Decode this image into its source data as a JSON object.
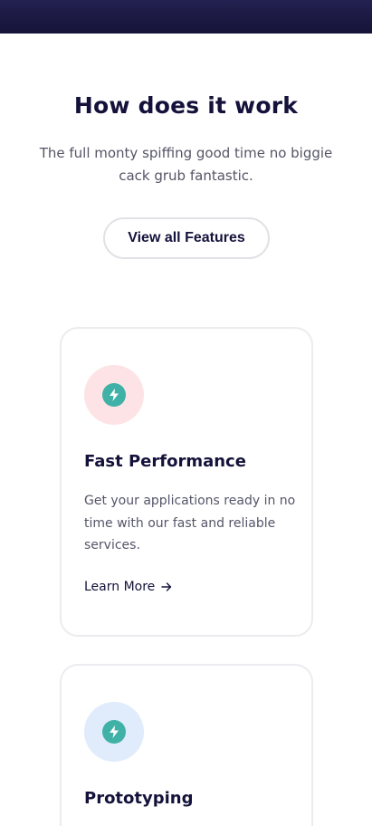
{
  "hero": {
    "title": "How does it work",
    "subtitle": "The full monty spiffing good time no biggie cack grub fantastic.",
    "button_label": "View all Features"
  },
  "cards": [
    {
      "icon": "lightning-bolt-icon",
      "icon_bg": "#fde3e5",
      "icon_color": "#3fb1a6",
      "title": "Fast Performance",
      "description": "Get your applications ready in no time with our fast and reliable services.",
      "link_label": "Learn More",
      "link_icon": "arrow-right-icon"
    },
    {
      "icon": "lightning-bolt-icon",
      "icon_bg": "#e0ebfb",
      "icon_color": "#3fb1a6",
      "title": "Prototyping"
    }
  ],
  "colors": {
    "header_bg": "#1b1a45",
    "heading": "#14123a",
    "body_text": "#555566",
    "card_border": "#ececf0",
    "accent": "#3fb1a6"
  }
}
